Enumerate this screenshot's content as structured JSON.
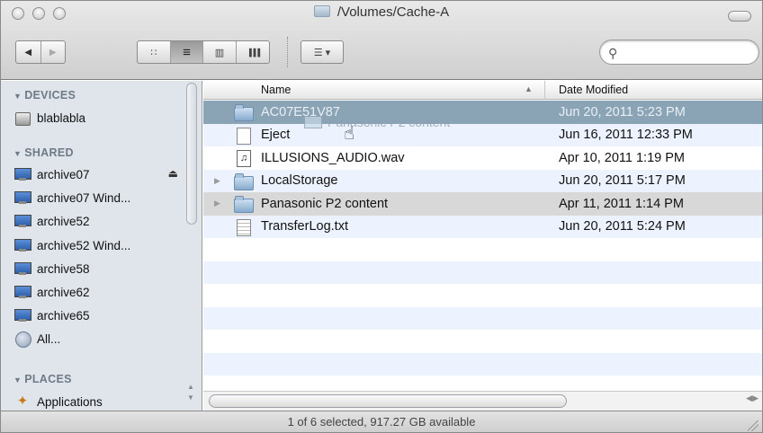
{
  "window": {
    "title": "/Volumes/Cache-A"
  },
  "toolbar": {
    "back_icon": "◀",
    "forward_icon": "▶",
    "view_icon_label": "∷",
    "view_list_label": "≡",
    "view_column_label": "▥",
    "view_coverflow_label": "▐▐▐",
    "arrange_label": "☰ ▾",
    "search": {
      "value": "",
      "placeholder": ""
    }
  },
  "sidebar": {
    "devices_header": "DEVICES",
    "devices": [
      {
        "label": "blablabla",
        "icon": "disk-icon"
      }
    ],
    "shared_header": "SHARED",
    "shared": [
      {
        "label": "archive07",
        "icon": "monitor-icon"
      },
      {
        "label": "archive07 Wind...",
        "icon": "monitor-icon"
      },
      {
        "label": "archive52",
        "icon": "monitor-icon"
      },
      {
        "label": "archive52 Wind...",
        "icon": "monitor-icon"
      },
      {
        "label": "archive58",
        "icon": "monitor-icon"
      },
      {
        "label": "archive62",
        "icon": "monitor-icon"
      },
      {
        "label": "archive65",
        "icon": "monitor-icon"
      },
      {
        "label": "All...",
        "icon": "globe-icon"
      }
    ],
    "places_header": "PLACES",
    "places": [
      {
        "label": "Applications",
        "icon": "applications-icon"
      }
    ]
  },
  "list": {
    "columns": {
      "name": "Name",
      "date": "Date Modified"
    },
    "rows": [
      {
        "name": "AC07E51V87",
        "date": "Jun 20, 2011 5:23 PM",
        "icon": "folder-icon",
        "selected": true
      },
      {
        "name": "Eject",
        "date": "Jun 16, 2011 12:33 PM",
        "icon": "document-icon"
      },
      {
        "name": "ILLUSIONS_AUDIO.wav",
        "date": "Apr 10, 2011 1:19 PM",
        "icon": "audio-file-icon"
      },
      {
        "name": "LocalStorage",
        "date": "Jun 20, 2011 5:17 PM",
        "icon": "folder-icon"
      },
      {
        "name": "Panasonic P2 content",
        "date": "Apr 11, 2011 1:14 PM",
        "icon": "folder-icon",
        "drop_target": true
      },
      {
        "name": "TransferLog.txt",
        "date": "Jun 20, 2011 5:24 PM",
        "icon": "text-file-icon"
      }
    ],
    "drag_ghost_label": "Panasonic P2 content"
  },
  "status": {
    "text": "1 of 6 selected, 917.27 GB available"
  }
}
